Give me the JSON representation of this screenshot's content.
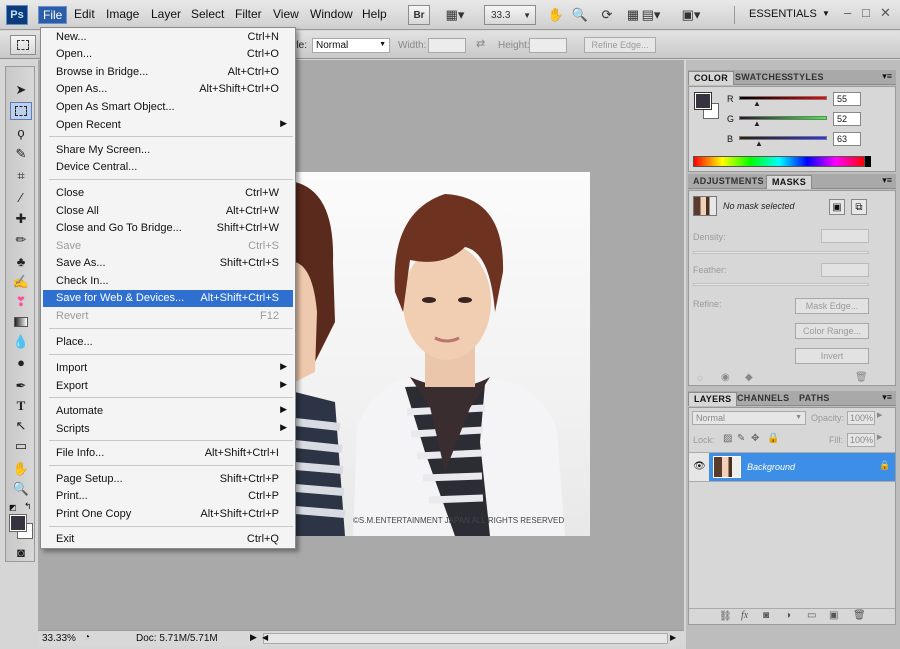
{
  "app": {
    "logo": "Ps"
  },
  "menubar": {
    "items": [
      "File",
      "Edit",
      "Image",
      "Layer",
      "Select",
      "Filter",
      "View",
      "Window",
      "Help"
    ],
    "bridge_label": "Br",
    "zoom": "33.3",
    "workspace": "ESSENTIALS",
    "window_controls": [
      "–",
      "□",
      "✕"
    ]
  },
  "options_bar": {
    "style_label": "Style:",
    "style_value": "Normal",
    "width_label": "Width:",
    "height_label": "Height:",
    "refine_edge": "Refine Edge..."
  },
  "file_menu": {
    "items": [
      {
        "label": "New...",
        "shortcut": "Ctrl+N"
      },
      {
        "label": "Open...",
        "shortcut": "Ctrl+O"
      },
      {
        "label": "Browse in Bridge...",
        "shortcut": "Alt+Ctrl+O"
      },
      {
        "label": "Open As...",
        "shortcut": "Alt+Shift+Ctrl+O"
      },
      {
        "label": "Open As Smart Object...",
        "shortcut": ""
      },
      {
        "label": "Open Recent",
        "shortcut": "",
        "submenu": true
      },
      {
        "label": "Share My Screen...",
        "shortcut": ""
      },
      {
        "label": "Device Central...",
        "shortcut": ""
      },
      {
        "label": "Close",
        "shortcut": "Ctrl+W"
      },
      {
        "label": "Close All",
        "shortcut": "Alt+Ctrl+W"
      },
      {
        "label": "Close and Go To Bridge...",
        "shortcut": "Shift+Ctrl+W"
      },
      {
        "label": "Save",
        "shortcut": "Ctrl+S",
        "disabled": true
      },
      {
        "label": "Save As...",
        "shortcut": "Shift+Ctrl+S"
      },
      {
        "label": "Check In...",
        "shortcut": ""
      },
      {
        "label": "Save for Web & Devices...",
        "shortcut": "Alt+Shift+Ctrl+S",
        "selected": true
      },
      {
        "label": "Revert",
        "shortcut": "F12",
        "disabled": true
      },
      {
        "label": "Place...",
        "shortcut": ""
      },
      {
        "label": "Import",
        "shortcut": "",
        "submenu": true
      },
      {
        "label": "Export",
        "shortcut": "",
        "submenu": true
      },
      {
        "label": "Automate",
        "shortcut": "",
        "submenu": true
      },
      {
        "label": "Scripts",
        "shortcut": "",
        "submenu": true
      },
      {
        "label": "File Info...",
        "shortcut": "Alt+Shift+Ctrl+I"
      },
      {
        "label": "Page Setup...",
        "shortcut": "Shift+Ctrl+P"
      },
      {
        "label": "Print...",
        "shortcut": "Ctrl+P"
      },
      {
        "label": "Print One Copy",
        "shortcut": "Alt+Shift+Ctrl+P"
      },
      {
        "label": "Exit",
        "shortcut": "Ctrl+Q"
      }
    ]
  },
  "color_panel": {
    "tabs": [
      "COLOR",
      "SWATCHES",
      "STYLES"
    ],
    "channels": [
      {
        "name": "R",
        "value": "55"
      },
      {
        "name": "G",
        "value": "52"
      },
      {
        "name": "B",
        "value": "63"
      }
    ],
    "foreground_color": "#37343f"
  },
  "adjust_panel": {
    "tabs": [
      "ADJUSTMENTS",
      "MASKS"
    ],
    "status": "No mask selected",
    "density_label": "Density:",
    "feather_label": "Feather:",
    "refine_label": "Refine:",
    "mask_edge": "Mask Edge...",
    "color_range": "Color Range...",
    "invert": "Invert"
  },
  "layers_panel": {
    "tabs": [
      "LAYERS",
      "CHANNELS",
      "PATHS"
    ],
    "blend_mode": "Normal",
    "opacity_label": "Opacity:",
    "opacity_value": "100%",
    "lock_label": "Lock:",
    "fill_label": "Fill:",
    "fill_value": "100%",
    "layer_name": "Background"
  },
  "canvas": {
    "watermark": "©S.M.ENTERTAINMENT JAPAN ALL RIGHTS RESERVED"
  },
  "status_bar": {
    "zoom": "33.33%",
    "doc_info": "Doc: 5.71M/5.71M"
  }
}
